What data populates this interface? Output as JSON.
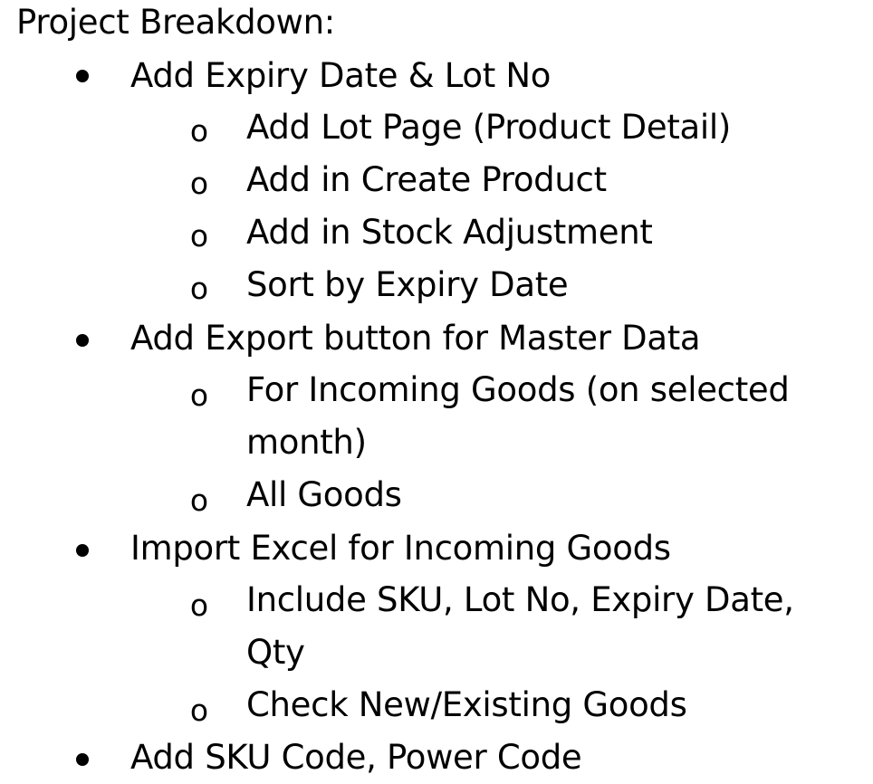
{
  "document": {
    "title": "Project Breakdown:",
    "sub_marker": "o",
    "items": [
      {
        "label": "Add Expiry Date & Lot No",
        "children": [
          "Add Lot Page (Product Detail)",
          "Add in Create Product",
          "Add in Stock Adjustment",
          "Sort by Expiry Date"
        ]
      },
      {
        "label": "Add Export button for Master Data",
        "children": [
          "For Incoming Goods (on selected",
          "month)",
          "All Goods"
        ]
      },
      {
        "label": "Import Excel for Incoming Goods",
        "children": [
          "Include SKU, Lot No, Expiry Date,",
          "Qty",
          "Check New/Existing Goods"
        ]
      },
      {
        "label": "Add SKU Code, Power Code",
        "children": []
      }
    ]
  }
}
